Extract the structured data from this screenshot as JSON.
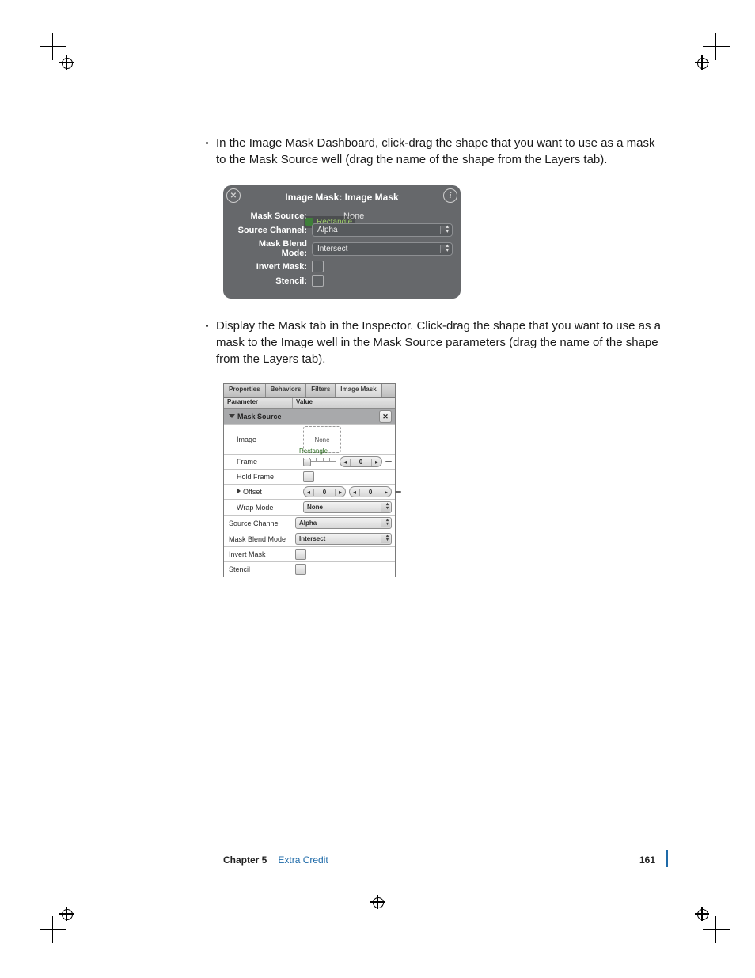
{
  "body": {
    "bullet1": "In the Image Mask Dashboard, click-drag the shape that you want to use as a mask to the Mask Source well (drag the name of the shape from the Layers tab).",
    "bullet2": "Display the Mask tab in the Inspector. Click-drag the shape that you want to use as a mask to the Image well in the Mask Source parameters (drag the name of the shape from the Layers tab)."
  },
  "hud": {
    "title": "Image Mask: Image Mask",
    "close_glyph": "✕",
    "info_glyph": "i",
    "rows": {
      "mask_source_label": "Mask Source:",
      "mask_source_value": "None",
      "drag_chip": "Rectangle",
      "source_channel_label": "Source Channel:",
      "source_channel_value": "Alpha",
      "blend_mode_label": "Mask Blend Mode:",
      "blend_mode_value": "Intersect",
      "invert_label": "Invert Mask:",
      "stencil_label": "Stencil:"
    }
  },
  "inspector": {
    "tabs": [
      "Properties",
      "Behaviors",
      "Filters",
      "Image Mask"
    ],
    "active_tab_index": 3,
    "columns": {
      "parameter": "Parameter",
      "value": "Value"
    },
    "mask_source_header": "Mask Source",
    "clear_glyph": "✕",
    "image_label": "Image",
    "image_value": "None",
    "image_chip": "Rectangle",
    "frame_label": "Frame",
    "frame_value": "0",
    "hold_frame_label": "Hold Frame",
    "offset_label": "Offset",
    "offset_x": "0",
    "offset_y": "0",
    "wrap_mode_label": "Wrap Mode",
    "wrap_mode_value": "None",
    "source_channel_label": "Source Channel",
    "source_channel_value": "Alpha",
    "blend_mode_label": "Mask Blend Mode",
    "blend_mode_value": "Intersect",
    "invert_label": "Invert Mask",
    "stencil_label": "Stencil"
  },
  "footer": {
    "chapter": "Chapter 5",
    "title": "Extra Credit",
    "page": "161"
  },
  "glyphs": {
    "tri_left": "◂",
    "tri_right": "▸",
    "up": "▴",
    "down": "▾"
  }
}
